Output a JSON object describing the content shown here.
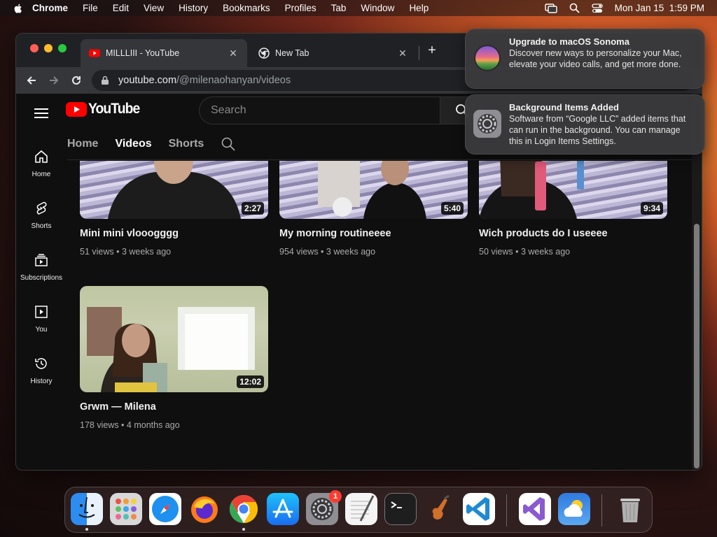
{
  "menubar": {
    "app": "Chrome",
    "items": [
      "File",
      "Edit",
      "View",
      "History",
      "Bookmarks",
      "Profiles",
      "Tab",
      "Window",
      "Help"
    ],
    "datetime": "Mon Jan 15  1:59 PM"
  },
  "browser": {
    "tabs": [
      {
        "title": "MILLLIII - YouTube",
        "favicon": "youtube-icon",
        "active": true
      },
      {
        "title": "New Tab",
        "favicon": "chrome-icon",
        "active": false
      }
    ],
    "url_host": "youtube.com",
    "url_path": "/@milenaohanyan/videos"
  },
  "youtube": {
    "logo_text": "YouTube",
    "search_placeholder": "Search",
    "guide": [
      {
        "label": "Home",
        "icon": "home-icon"
      },
      {
        "label": "Shorts",
        "icon": "shorts-icon"
      },
      {
        "label": "Subscriptions",
        "icon": "subscriptions-icon"
      },
      {
        "label": "You",
        "icon": "you-icon"
      },
      {
        "label": "History",
        "icon": "history-icon"
      }
    ],
    "channel_tabs": [
      {
        "label": "Home",
        "active": false
      },
      {
        "label": "Videos",
        "active": true
      },
      {
        "label": "Shorts",
        "active": false
      }
    ],
    "videos": [
      {
        "title": "Mini mini vlooogggg",
        "meta": "51 views • 3 weeks ago",
        "duration": "2:27"
      },
      {
        "title": "My morning routineeee",
        "meta": "954 views • 3 weeks ago",
        "duration": "5:40"
      },
      {
        "title": "Wich products do I useeee",
        "meta": "50 views • 3 weeks ago",
        "duration": "9:34"
      },
      {
        "title": "Grwm — Milena",
        "meta": "178 views • 4 months ago",
        "duration": "12:02"
      }
    ]
  },
  "notifications": [
    {
      "title": "Upgrade to macOS Sonoma",
      "body": "Discover new ways to personalize your Mac, elevate your video calls, and get more done.",
      "icon": "macos-sonoma-icon"
    },
    {
      "title": "Background Items Added",
      "body": "Software from “Google LLC” added items that can run in the background. You can manage this in Login Items Settings.",
      "icon": "system-settings-icon"
    }
  ],
  "dock": {
    "apps": [
      "Finder",
      "Launchpad",
      "Safari",
      "Firefox",
      "Chrome",
      "App Store",
      "System Settings",
      "TextEdit",
      "Terminal",
      "GarageBand",
      "Visual Studio Code",
      "Visual Studio",
      "Weather",
      "Trash"
    ],
    "settings_badge": "1"
  },
  "colors": {
    "youtube_red": "#ff0000",
    "page_bg": "#0f0f0f",
    "chrome_toolbar": "#35363a"
  }
}
